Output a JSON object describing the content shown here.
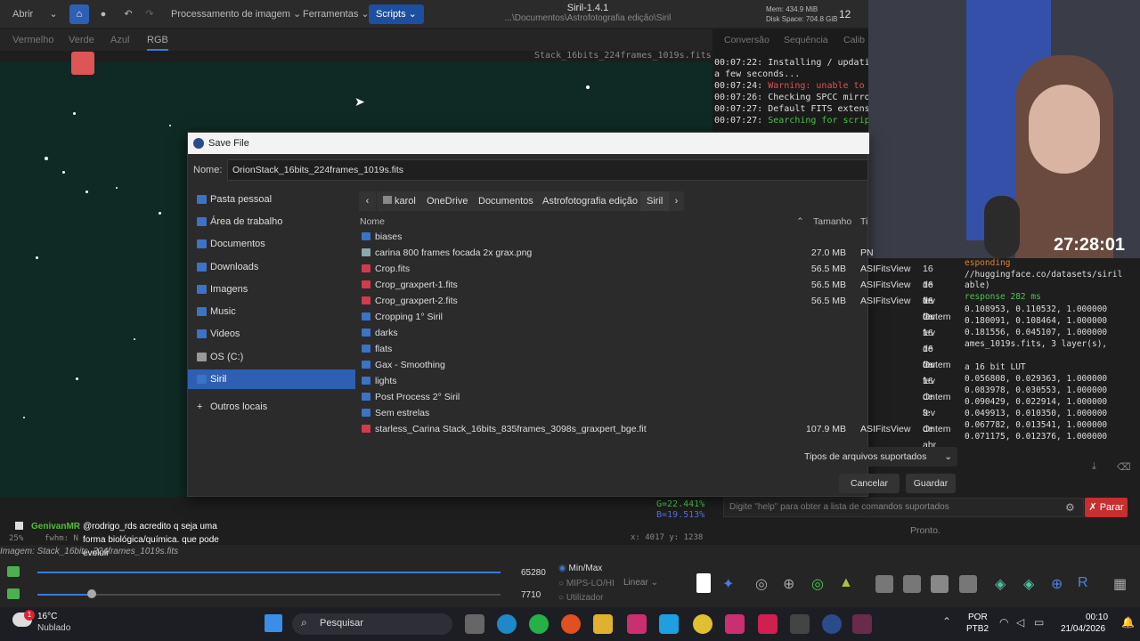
{
  "toolbar": {
    "open_label": "Abrir",
    "image_processing_menu": "Processamento de imagem",
    "tools_menu": "Ferramentas",
    "scripts_menu": "Scripts"
  },
  "window": {
    "title": "Siril-1.4.1",
    "path": "...\\Documentos\\Astrofotografia edição\\Siril",
    "mem": "Mem: 434.9 MiB",
    "disk": "Disk Space: 704.8 GiB",
    "threads": "12"
  },
  "channels": [
    "Vermelho",
    "Verde",
    "Azul",
    "RGB"
  ],
  "image_name_top": "Stack_16bits_224frames_1019s.fits",
  "right_tabs": [
    "Conversão",
    "Sequência",
    "Calib"
  ],
  "log": [
    {
      "time": "00:07:22:",
      "text": "Installing / updati",
      "color": "#dddddd"
    },
    {
      "time": "",
      "text": "a few seconds...",
      "color": "#dddddd"
    },
    {
      "time": "00:07:24:",
      "text": "Warning: unable to",
      "color": "#e05050"
    },
    {
      "time": "00:07:26:",
      "text": "Checking SPCC mirro",
      "color": "#dddddd"
    },
    {
      "time": "00:07:27:",
      "text": "Default FITS extens",
      "color": "#dddddd"
    },
    {
      "time": "00:07:27:",
      "text": "Searching for scrip",
      "color": "#50c050"
    }
  ],
  "dialog": {
    "title": "Save File",
    "name_label": "Nome:",
    "filename": "OrionStack_16bits_224frames_1019s.fits",
    "sidebar": [
      "Pasta pessoal",
      "Área de trabalho",
      "Documentos",
      "Downloads",
      "Imagens",
      "Music",
      "Videos",
      "OS (C:)",
      "Siril"
    ],
    "other_locations": "Outros locais",
    "path": [
      "karol",
      "OneDrive",
      "Documentos",
      "Astrofotografia edição",
      "Siril"
    ],
    "columns": {
      "name": "Nome",
      "size": "Tamanho",
      "type": "Ti"
    },
    "files": [
      {
        "name": "biases",
        "size": "",
        "type": "",
        "date": "",
        "kind": "folder"
      },
      {
        "name": "carina 800 frames focada 2x grax.png",
        "size": "27.0 MB",
        "type": "PN",
        "date": "",
        "kind": "image"
      },
      {
        "name": "Crop.fits",
        "size": "56.5 MB",
        "type": "ASIFitsView",
        "date": "16 de fev",
        "kind": "fits"
      },
      {
        "name": "Crop_graxpert-1.fits",
        "size": "56.5 MB",
        "type": "ASIFitsView",
        "date": "16 de fev",
        "kind": "fits"
      },
      {
        "name": "Crop_graxpert-2.fits",
        "size": "56.5 MB",
        "type": "ASIFitsView",
        "date": "16 de fev",
        "kind": "fits"
      },
      {
        "name": "Cropping 1° Siril",
        "size": "",
        "type": "",
        "date": "Ontem",
        "kind": "folder"
      },
      {
        "name": "darks",
        "size": "",
        "type": "",
        "date": "16 de fev",
        "kind": "folder"
      },
      {
        "name": "flats",
        "size": "",
        "type": "",
        "date": "16 de fev",
        "kind": "folder"
      },
      {
        "name": "Gax - Smoothing",
        "size": "",
        "type": "",
        "date": "Ontem",
        "kind": "folder"
      },
      {
        "name": "lights",
        "size": "",
        "type": "",
        "date": "16 de fev",
        "kind": "folder"
      },
      {
        "name": "Post Process 2° Siril",
        "size": "",
        "type": "",
        "date": "Ontem",
        "kind": "folder"
      },
      {
        "name": "Sem estrelas",
        "size": "",
        "type": "",
        "date": "3 de abr",
        "kind": "folder"
      },
      {
        "name": "starless_Carina Stack_16bits_835frames_3098s_graxpert_bge.fit",
        "size": "107.9 MB",
        "type": "ASIFitsView",
        "date": "Ontem",
        "kind": "fits"
      }
    ],
    "filter": "Tipos de arquivos suportados",
    "cancel": "Cancelar",
    "save": "Guardar"
  },
  "stream_timer": "27:28:01",
  "right_log": [
    "esponding",
    "//huggingface.co/datasets/siril",
    "able)",
    " response 282 ms",
    " 0.108953, 0.110532, 1.000000",
    " 0.180091, 0.108464, 1.000000",
    " 0.181556, 0.045107, 1.000000",
    "ames_1019s.fits, 3 layer(s),",
    "",
    " a 16 bit LUT",
    " 0.056808, 0.029363, 1.000000",
    " 0.083978, 0.030553, 1.000000",
    " 0.090429, 0.022914, 1.000000",
    " 0.049913, 0.010350, 1.000000",
    " 0.067782, 0.013541, 1.000000",
    " 0.071175, 0.012376, 1.000000"
  ],
  "command_placeholder": "Digite \"help\" para obter a lista de comandos suportados",
  "stop_button": "Parar",
  "status_ready": "Pronto.",
  "pixel_readout": {
    "g": "G=22.441%",
    "b": "B=19.513%",
    "coords": "x: 4017 y: 1238"
  },
  "chat": {
    "user": "GenivanMR",
    "line1": "@rodrigo_rds acredito q seja uma",
    "line2": "forma biológica/química. que pode",
    "line3": "evoluir"
  },
  "status_image": "Imagem: Stack_16bits_224frames_1019s.fits",
  "fwhm_label": "fwhm: N",
  "zoom_pct": "25%",
  "sliders": {
    "max_value": "65280",
    "min_value": "7710"
  },
  "display_modes": [
    "Min/Max",
    "MIPS-LO/HI",
    "Utilizador"
  ],
  "stretch_mode": "Linear",
  "weather": {
    "temp": "16°C",
    "condition": "Nublado",
    "badge": "1"
  },
  "search": "Pesquisar",
  "lang": {
    "l1": "POR",
    "l2": "PTB2"
  },
  "clock": {
    "time": "00:10",
    "date": "21/04/2026"
  }
}
